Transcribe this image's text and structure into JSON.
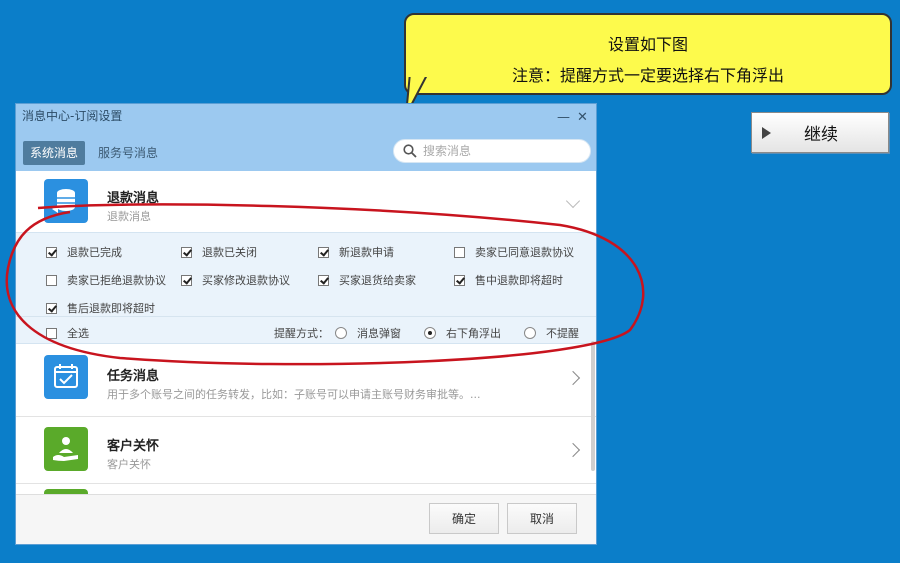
{
  "callout": {
    "line1": "设置如下图",
    "line2": "注意：提醒方式一定要选择右下角浮出"
  },
  "continue_button": {
    "label": "继续",
    "icon": "play-icon"
  },
  "dialog": {
    "title": "消息中心-订阅设置",
    "window_controls": {
      "minimize": "—",
      "close": "✕"
    },
    "tabs": [
      {
        "label": "系统消息",
        "active": true
      },
      {
        "label": "服务号消息",
        "active": false
      }
    ],
    "search": {
      "placeholder": "搜索消息",
      "icon": "search-icon"
    },
    "categories": [
      {
        "title": "退款消息",
        "subtitle": "退款消息",
        "icon": "refund-icon",
        "color": "#2b90e0",
        "expanded": true
      },
      {
        "title": "任务消息",
        "subtitle": "用于多个账号之间的任务转发，比如：子账号可以申请主账号财务审批等。...",
        "icon": "calendar-icon",
        "color": "#2b90e0",
        "expanded": false
      },
      {
        "title": "客户关怀",
        "subtitle": "客户关怀",
        "icon": "care-icon",
        "color": "#5aaa2a",
        "expanded": false
      }
    ],
    "refund_options": [
      {
        "label": "退款已完成",
        "checked": true
      },
      {
        "label": "退款已关闭",
        "checked": true
      },
      {
        "label": "新退款申请",
        "checked": true
      },
      {
        "label": "卖家已同意退款协议",
        "checked": false
      },
      {
        "label": "卖家已拒绝退款协议",
        "checked": false
      },
      {
        "label": "买家修改退款协议",
        "checked": true
      },
      {
        "label": "买家退货给卖家",
        "checked": true
      },
      {
        "label": "售中退款即将超时",
        "checked": true
      },
      {
        "label": "售后退款即将超时",
        "checked": true
      }
    ],
    "select_all": {
      "label": "全选",
      "checked": false
    },
    "reminder": {
      "label": "提醒方式：",
      "options": [
        {
          "label": "消息弹窗",
          "selected": false
        },
        {
          "label": "右下角浮出",
          "selected": true
        },
        {
          "label": "不提醒",
          "selected": false
        }
      ]
    },
    "buttons": {
      "ok": "确定",
      "cancel": "取消"
    }
  },
  "colors": {
    "background": "#0b7ec9",
    "callout": "#fdfa4c",
    "annotation": "#c8141e"
  }
}
